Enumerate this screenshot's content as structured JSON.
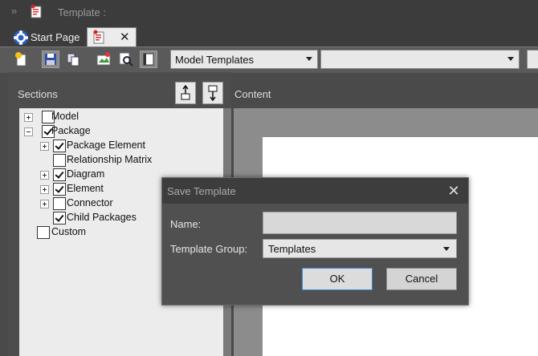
{
  "title": {
    "text": "Template :"
  },
  "tabs": [
    {
      "label": "Start Page"
    },
    {
      "label": ""
    }
  ],
  "toolbar": {
    "template_type": "Model Templates",
    "template_name": ""
  },
  "panels": {
    "sections_label": "Sections",
    "content_label": "Content"
  },
  "tree": [
    {
      "label": "Model",
      "checked": false,
      "expander": "plus"
    },
    {
      "label": "Package",
      "checked": true,
      "expander": "minus"
    },
    {
      "label": "Package Element",
      "checked": true,
      "expander": "plus"
    },
    {
      "label": "Relationship Matrix",
      "checked": false,
      "expander": "none"
    },
    {
      "label": "Diagram",
      "checked": true,
      "expander": "plus"
    },
    {
      "label": "Element",
      "checked": true,
      "expander": "plus"
    },
    {
      "label": "Connector",
      "checked": false,
      "expander": "plus"
    },
    {
      "label": "Child Packages",
      "checked": true,
      "expander": "none"
    },
    {
      "label": "Custom",
      "checked": false,
      "expander": "none"
    }
  ],
  "dialog": {
    "title": "Save Template",
    "name_label": "Name:",
    "name_value": "",
    "group_label": "Template Group:",
    "group_value": "Templates",
    "ok_label": "OK",
    "cancel_label": "Cancel"
  },
  "colors": {
    "tree_bg": "#ececec",
    "dialog_bg": "#505050",
    "ok_border": "#3a86d8"
  }
}
